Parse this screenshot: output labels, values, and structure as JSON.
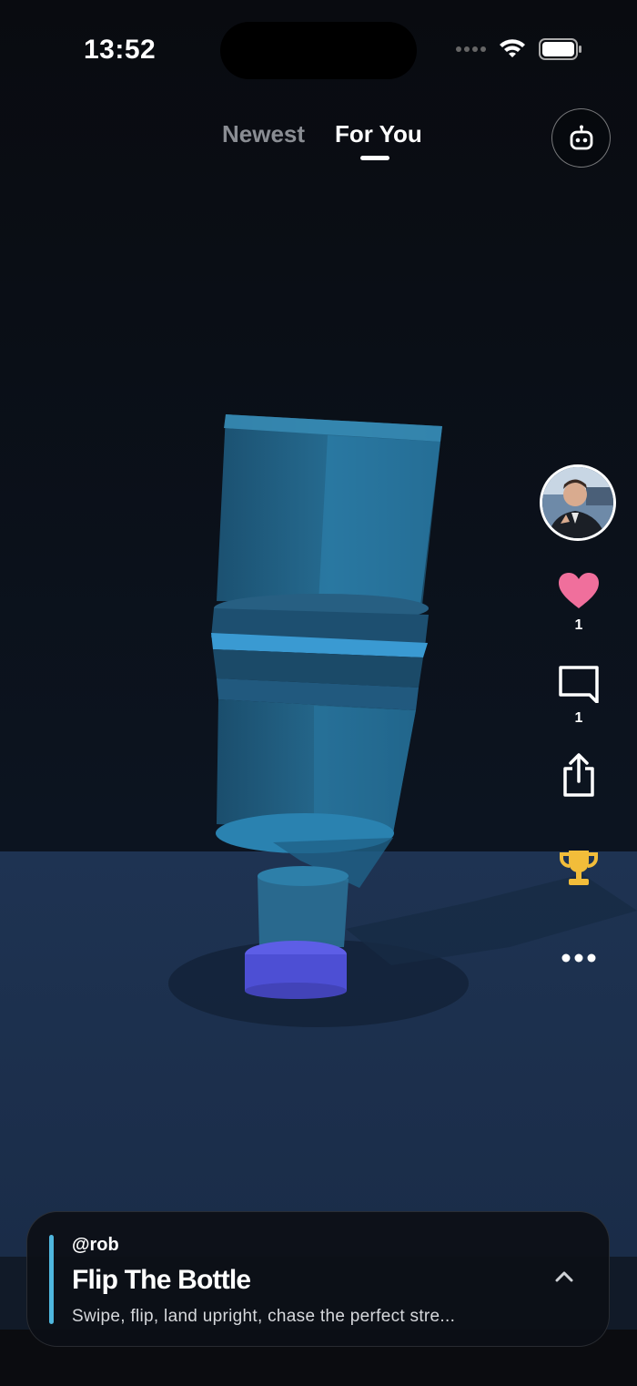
{
  "status_bar": {
    "time": "13:52",
    "icons": [
      "signal-icon",
      "wifi-icon",
      "battery-icon"
    ]
  },
  "tabs": [
    {
      "label": "Newest",
      "active": false
    },
    {
      "label": "For You",
      "active": true
    }
  ],
  "ai_button": {
    "icon": "robot-icon"
  },
  "actions": {
    "avatar": {
      "icon": "avatar"
    },
    "like": {
      "icon": "heart-icon",
      "count": "1",
      "color": "#f06f9c"
    },
    "comment": {
      "icon": "comment-icon",
      "count": "1"
    },
    "share": {
      "icon": "share-icon"
    },
    "leaderboard": {
      "icon": "trophy-icon",
      "color": "#f2bd3a"
    },
    "more": {
      "icon": "more-icon"
    }
  },
  "post": {
    "username": "@rob",
    "title": "Flip The Bottle",
    "description": "Swipe, flip, land upright, chase the perfect stre...",
    "accent_color": "#4fb7de"
  }
}
